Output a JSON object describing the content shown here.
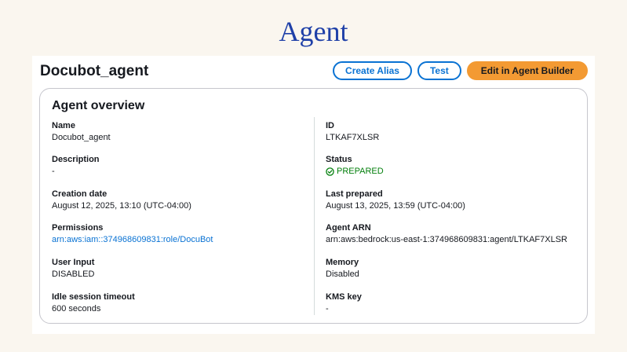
{
  "slide": {
    "title": "Agent"
  },
  "agent": {
    "name": "Docubot_agent"
  },
  "actions": {
    "create_alias": "Create Alias",
    "test": "Test",
    "edit": "Edit in Agent Builder"
  },
  "overview": {
    "title": "Agent overview",
    "left": [
      {
        "label": "Name",
        "value": "Docubot_agent"
      },
      {
        "label": "Description",
        "value": "-"
      },
      {
        "label": "Creation date",
        "value": "August 12, 2025, 13:10 (UTC-04:00)"
      },
      {
        "label": "Permissions",
        "value": "arn:aws:iam::374968609831:role/DocuBot"
      },
      {
        "label": "User Input",
        "value": "DISABLED"
      },
      {
        "label": "Idle session timeout",
        "value": "600 seconds"
      }
    ],
    "right": [
      {
        "label": "ID",
        "value": "LTKAF7XLSR"
      },
      {
        "label": "Status",
        "value": "PREPARED"
      },
      {
        "label": "Last prepared",
        "value": "August 13, 2025, 13:59 (UTC-04:00)"
      },
      {
        "label": "Agent ARN",
        "value": "arn:aws:bedrock:us-east-1:374968609831:agent/LTKAF7XLSR"
      },
      {
        "label": "Memory",
        "value": "Disabled"
      },
      {
        "label": "KMS key",
        "value": "-"
      }
    ]
  },
  "icons": {
    "status": "check-circle-icon"
  },
  "colors": {
    "title": "#1f40a8",
    "link": "#0972d3",
    "status_success": "#037f0c",
    "primary_button": "#f39a33",
    "background": "#faf6ef"
  }
}
